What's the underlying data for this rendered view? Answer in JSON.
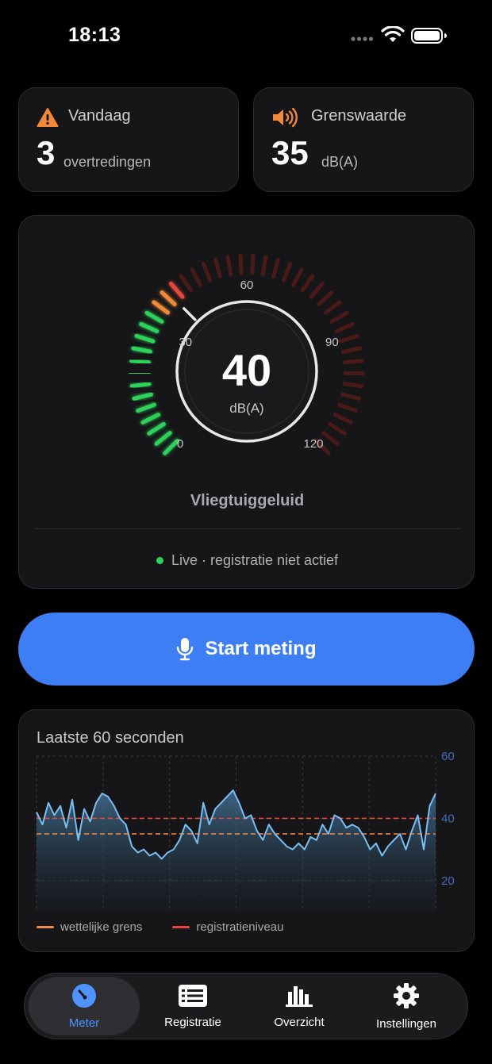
{
  "status_bar": {
    "time": "18:13"
  },
  "stats": {
    "today": {
      "title": "Vandaag",
      "value": "3",
      "unit": "overtredingen",
      "icon": "warning-icon"
    },
    "limit": {
      "title": "Grenswaarde",
      "value": "35",
      "unit": "dB(A)",
      "icon": "speaker-icon"
    }
  },
  "meter": {
    "value": "40",
    "unit": "dB(A)",
    "scale_labels": [
      "0",
      "30",
      "60",
      "90",
      "120"
    ],
    "level": 40,
    "max": 120,
    "caption": "Vliegtuiggeluid",
    "status": "Live · registratie niet actief",
    "colors": {
      "green": "#2fd15a",
      "orange": "#f08a3a",
      "red": "#e5473a",
      "inactive": "#4a1a18"
    }
  },
  "start_button": {
    "label": "Start meting",
    "icon": "microphone-icon"
  },
  "chart": {
    "title": "Laatste 60 seconden",
    "legend": [
      {
        "label": "wettelijke grens",
        "color": "#f0894a"
      },
      {
        "label": "registratieniveau",
        "color": "#e5473a"
      }
    ]
  },
  "chart_data": {
    "type": "area",
    "title": "Laatste 60 seconden",
    "xlabel": "",
    "ylabel": "",
    "ylim": [
      10,
      60
    ],
    "y_ticks": [
      "60",
      "40",
      "20"
    ],
    "x": [
      0,
      1,
      2,
      3,
      4,
      5,
      6,
      7,
      8,
      9,
      10,
      11,
      12,
      13,
      14,
      15,
      16,
      17,
      18,
      19,
      20,
      21,
      22,
      23,
      24,
      25,
      26,
      27,
      28,
      29,
      30,
      31,
      32,
      33,
      34,
      35,
      36,
      37,
      38,
      39,
      40,
      41,
      42,
      43,
      44,
      45,
      46,
      47,
      48,
      49,
      50,
      51,
      52,
      53,
      54,
      55,
      56,
      57,
      58,
      59,
      60
    ],
    "series": [
      {
        "values": [
          42,
          38,
          45,
          41,
          44,
          37,
          46,
          33,
          43,
          39,
          45,
          48,
          47,
          44,
          40,
          38,
          31,
          29,
          30,
          28,
          29,
          27,
          29,
          30,
          33,
          38,
          36,
          32,
          45,
          38,
          43,
          45,
          47,
          49,
          45,
          40,
          41,
          36,
          33,
          38,
          35,
          33,
          31,
          30,
          32,
          30,
          34,
          33,
          38,
          35,
          41,
          40,
          37,
          38,
          37,
          34,
          30,
          32,
          28,
          31,
          33,
          35,
          30,
          36,
          41,
          30,
          44,
          48
        ]
      }
    ],
    "thresholds": [
      {
        "label": "wettelijke grens",
        "value": 35
      },
      {
        "label": "registratieniveau",
        "value": 40
      }
    ],
    "grid": true
  },
  "tabbar": {
    "items": [
      {
        "label": "Meter",
        "icon": "gauge-icon",
        "active": true
      },
      {
        "label": "Registratie",
        "icon": "list-icon",
        "active": false
      },
      {
        "label": "Overzicht",
        "icon": "bar-chart-icon",
        "active": false
      },
      {
        "label": "Instellingen",
        "icon": "gear-icon",
        "active": false
      }
    ]
  }
}
